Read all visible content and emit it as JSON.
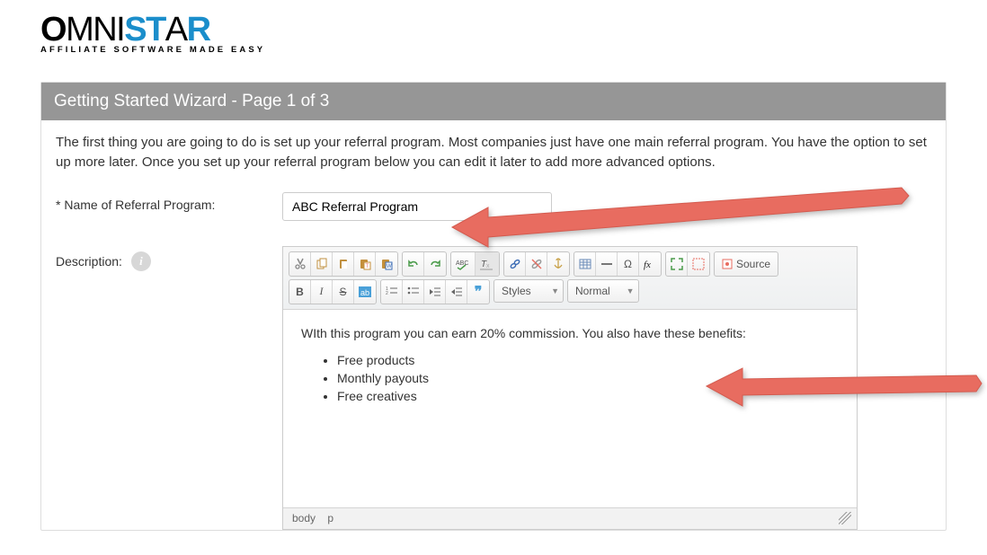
{
  "logo": {
    "brand_o": "O",
    "brand_mn": "MN",
    "brand_i": "I",
    "brand_st": "ST",
    "brand_a": "A",
    "brand_r": "R",
    "tagline": "AFFILIATE SOFTWARE MADE EASY"
  },
  "panel_title": "Getting Started Wizard - Page 1 of 3",
  "intro_text": "The first thing you are going to do is set up your referral program. Most companies just have one main referral program. You have the option to set up more later. Once you set up your referral program below you can edit it later to add more advanced options.",
  "form": {
    "name_label": "* Name of Referral Program:",
    "name_value": "ABC Referral Program",
    "desc_label": "Description:"
  },
  "editor": {
    "styles_combo": "Styles",
    "format_combo": "Normal",
    "source_label": "Source",
    "content_p": "WIth this program you can earn 20% commission. You also have these benefits:",
    "content_items": [
      "Free products",
      "Monthly payouts",
      "Free creatives"
    ],
    "path": [
      "body",
      "p"
    ]
  },
  "icons": {
    "bold": "B",
    "italic": "I",
    "strike": "S",
    "quote": "❞",
    "info": "i"
  }
}
